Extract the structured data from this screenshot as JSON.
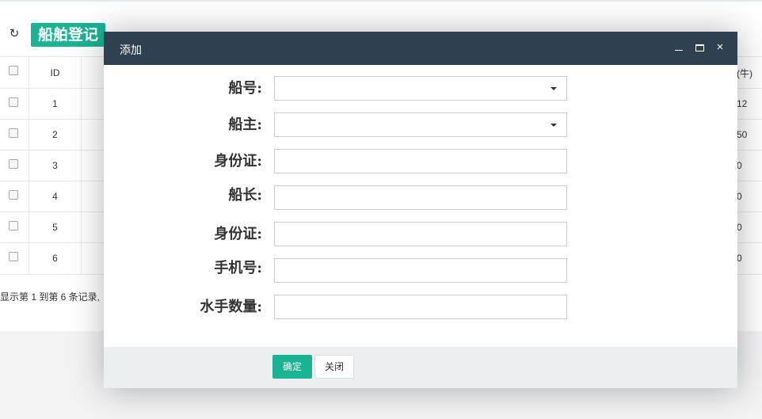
{
  "page": {
    "title": "船舶登记",
    "refresh_icon": "refresh-icon",
    "table": {
      "headers": {
        "id": "ID",
        "last": "(牛)"
      },
      "rows": [
        {
          "id": "1",
          "last": "12"
        },
        {
          "id": "2",
          "last": "50"
        },
        {
          "id": "3",
          "last": "0"
        },
        {
          "id": "4",
          "last": "0"
        },
        {
          "id": "5",
          "last": "0"
        },
        {
          "id": "6",
          "last": "0"
        }
      ]
    },
    "footer_text": "显示第 1 到第 6 条记录,"
  },
  "modal": {
    "title": "添加",
    "close_glyph": "×",
    "fields": [
      {
        "label": "船号:",
        "value": "",
        "type": "select"
      },
      {
        "label": "船主:",
        "value": "",
        "type": "select"
      },
      {
        "label": "身份证:",
        "value": "",
        "type": "text"
      },
      {
        "label": "船长:",
        "value": "",
        "type": "text"
      },
      {
        "label": "身份证:",
        "value": "",
        "type": "text"
      },
      {
        "label": "手机号:",
        "value": "",
        "type": "text"
      },
      {
        "label": "水手数量:",
        "value": "",
        "type": "text"
      }
    ],
    "buttons": {
      "ok": "确定",
      "close": "关闭"
    }
  },
  "colors": {
    "accent": "#1ab394",
    "header_dark": "#2f4050",
    "footer_gray": "#eceff0"
  }
}
